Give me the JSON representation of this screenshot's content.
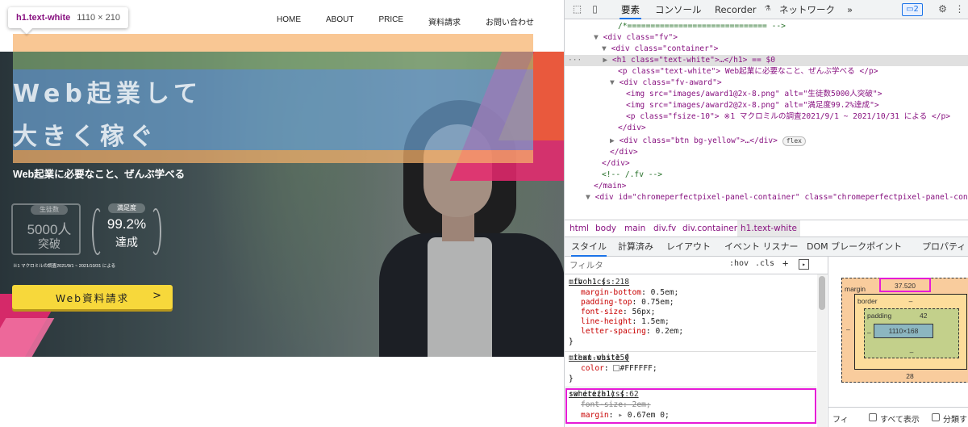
{
  "site": {
    "nav": [
      "HOME",
      "ABOUT",
      "PRICE",
      "資料請求",
      "お問い合わせ"
    ],
    "tooltip": {
      "name": "h1.text-white",
      "size": "1110 × 210"
    },
    "hero_title_lines": [
      "Web起業して",
      "大きく稼ぐ"
    ],
    "hero_sub": "Web起業に必要なこと、ぜんぶ学べる",
    "award1": {
      "label": "生徒数",
      "big": "5000人",
      "small": "突破"
    },
    "award2": {
      "label": "満足度",
      "big": "99.2%",
      "small": "達成"
    },
    "fsize_note": "※1 マクロミルの調査2021/9/1 ~ 2021/10/31 による",
    "cta_label": "Web資料請求",
    "cta_arrow": ">"
  },
  "devtools": {
    "tabs": [
      "要素",
      "コンソール",
      "Recorder",
      "ネットワーク"
    ],
    "more_tabs": "»",
    "message_count": "2",
    "dom_lines": [
      "/*============================== -->",
      "<div class=\"fv\">",
      "<div class=\"container\">",
      "<h1 class=\"text-white\">…</h1> == $0",
      "<p class=\"text-white\"> Web起業に必要なこと、ぜんぶ学べる </p>",
      "<div class=\"fv-award\">",
      "<img src=\"images/award1@2x-8.png\" alt=\"生徒数5000人突破\">",
      "<img src=\"images/award2@2x-8.png\" alt=\"満足度99.2%達成\">",
      "<p class=\"fsize-10\"> ※1 マクロミルの調査2021/9/1 ~ 2021/10/31 による </p>",
      "</div>",
      "<div class=\"btn bg-yellow\">…</div>",
      "</div>",
      "</div>",
      "<!-- /.fv -->",
      "</main>",
      "<div id=\"chromeperfectpixel-panel-container\" class=\"chromeperfectpixel-panel-cont"
    ],
    "flex_badge": "flex",
    "breadcrumb": [
      "html",
      "body",
      "main",
      "div.fv",
      "div.container",
      "h1.text-white"
    ],
    "subtabs": [
      "スタイル",
      "計算済み",
      "レイアウト",
      "イベント リスナー",
      "DOM ブレークポイント",
      "プロパティ"
    ],
    "filter_placeholder": "フィルタ",
    "filter_buttons": [
      ":hov",
      ".cls",
      "+"
    ],
    "rules": [
      {
        "selector": ".fv h1 {",
        "source": "mihon.css:218",
        "decls": [
          {
            "prop": "margin-bottom",
            "value": "0.5em;"
          },
          {
            "prop": "padding-top",
            "value": "0.75em;"
          },
          {
            "prop": "font-size",
            "value": "56px;"
          },
          {
            "prop": "line-height",
            "value": "1.5em;"
          },
          {
            "prop": "letter-spacing",
            "value": "0.2em;"
          }
        ]
      },
      {
        "selector": ".text-white {",
        "source": "mihon.css:150",
        "decls": [
          {
            "prop": "color",
            "value": "#FFFFFF;"
          }
        ]
      },
      {
        "selector": ":where(h1) {",
        "source": "sanitize.css:62",
        "decls": [
          {
            "prop": "font-size",
            "value": "2em;",
            "struck": true
          },
          {
            "prop": "margin",
            "value": "0.67em 0;"
          }
        ]
      }
    ],
    "close_brace": "}",
    "boxmodel": {
      "margin_label": "margin",
      "margin_top": "37.520",
      "margin_bottom": "28",
      "margin_side": "–",
      "border_label": "border",
      "border_value": "–",
      "padding_label": "padding",
      "padding_top": "42",
      "padding_bottom": "–",
      "padding_side": "–",
      "content": "1110×168"
    },
    "show_all": "すべて表示",
    "group": "分類す",
    "filter_bottom": "フィ",
    "accent": "#1a73e8",
    "highlight": "#e61bd6"
  }
}
